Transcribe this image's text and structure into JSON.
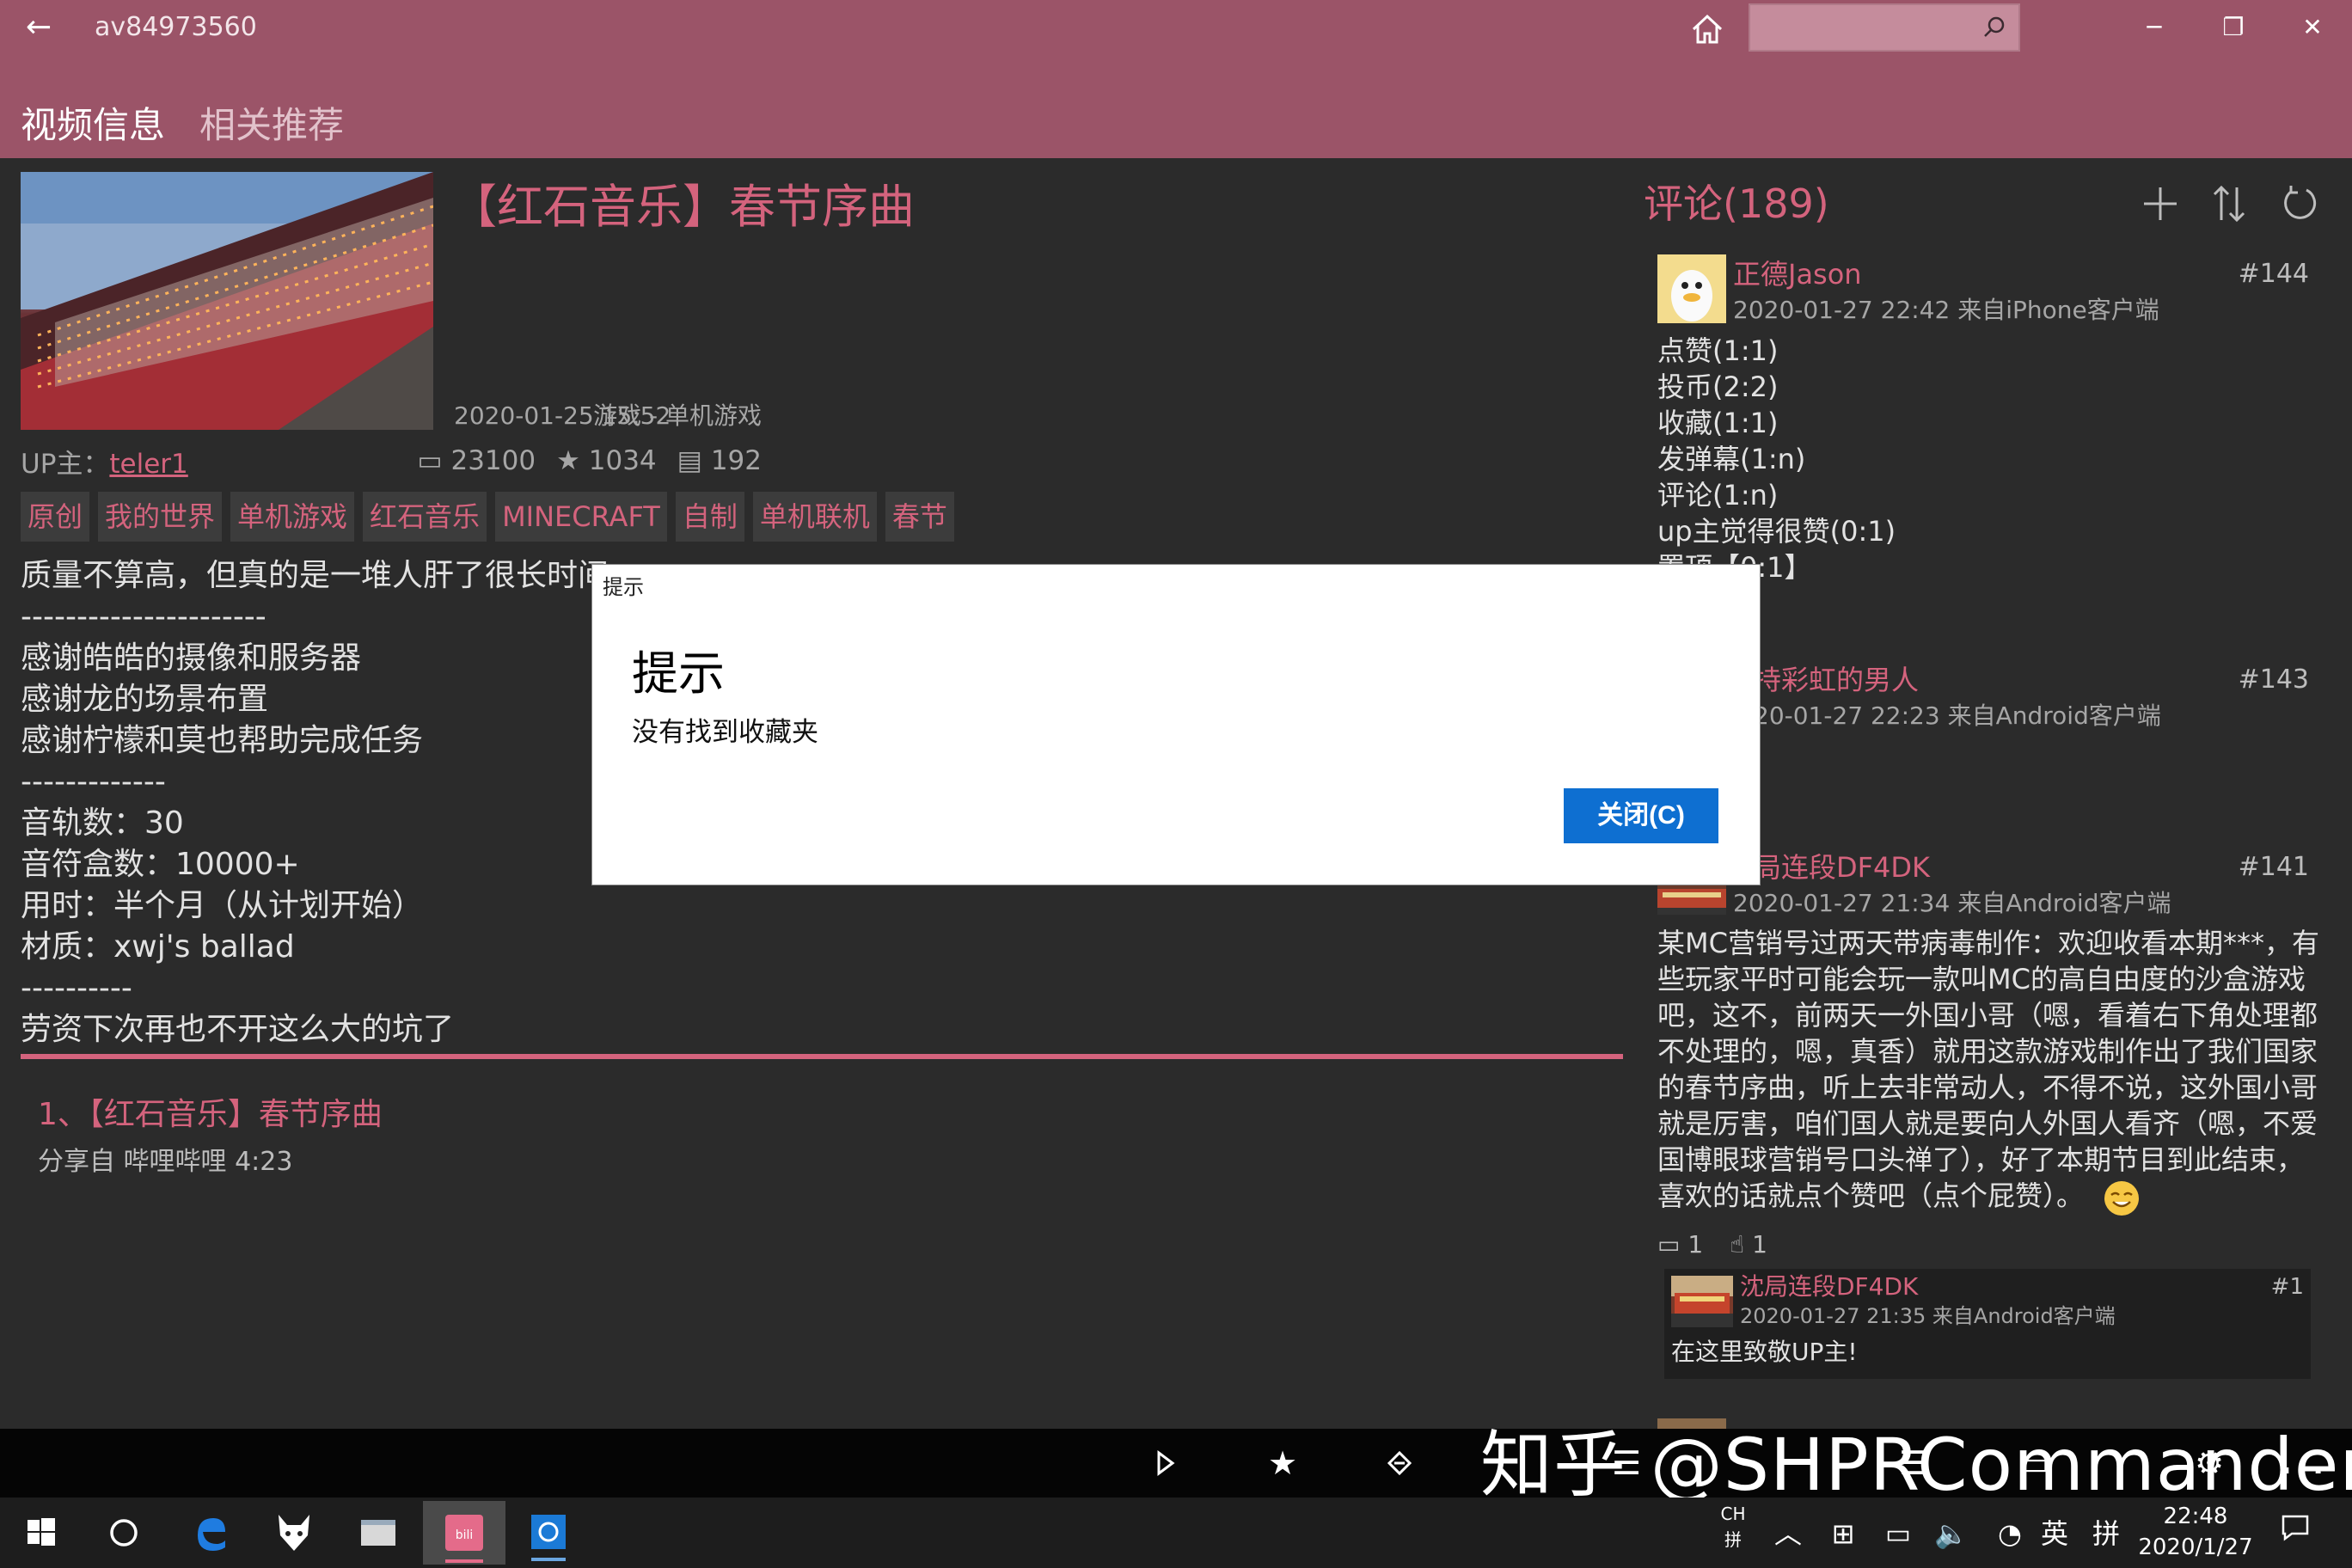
{
  "window": {
    "title": "av84973560",
    "back_icon": "←",
    "minimize": "─",
    "restore": "❐",
    "close": "✕"
  },
  "tabs": [
    "视频信息",
    "相关推荐"
  ],
  "video": {
    "title": "【红石音乐】春节序曲",
    "date": "2020-01-25 15:52",
    "category": "游戏 - 单机游戏",
    "up_label": "UP主：",
    "up_name": "teler1",
    "views": "23100",
    "favorites": "1034",
    "danmaku": "192",
    "tags": [
      "原创",
      "我的世界",
      "单机游戏",
      "红石音乐",
      "MINECRAFT",
      "自制",
      "单机联机",
      "春节"
    ],
    "description": [
      "质量不算高，但真的是一堆人肝了很长时间",
      "----------------------",
      "感谢皓皓的摄像和服务器",
      "感谢龙的场景布置",
      "感谢柠檬和莫也帮助完成任务",
      "-------------",
      "音轨数：30",
      "音符盒数：10000+",
      "用时：半个月（从计划开始）",
      "材质：xwj's ballad",
      "----------",
      "劳资下次再也不开这么大的坑了"
    ],
    "part_title": "1、【红石音乐】春节序曲",
    "part_info": "分享自 哔哩哔哩 4:23"
  },
  "comments": {
    "header": "评论(189)",
    "items": [
      {
        "user": "正德Jason",
        "num": "#144",
        "meta": "2020-01-27 22:42 来自iPhone客户端",
        "lines": [
          "点赞(1:1)",
          "投币(2:2)",
          "收藏(1:1)",
          "发弹幕(1:n)",
          "评论(1:n)",
          "up主觉得很赞(0:1)",
          "置顶【0:1】"
        ]
      },
      {
        "user": "持彩虹的男人",
        "num": "#143",
        "meta": "20-01-27 22:23 来自Android客户端"
      },
      {
        "user": "局连段DF4DK",
        "num": "#141",
        "meta": "2020-01-27 21:34 来自Android客户端",
        "lines": [
          "某MC营销号过两天带病毒制作：欢迎收看本期***，有",
          "些玩家平时可能会玩一款叫MC的高自由度的沙盒游戏",
          "吧，这不，前两天一外国小哥（嗯，看着右下角处理都",
          "不处理的，嗯，真香）就用这款游戏制作出了我们国家",
          "的春节序曲，听上去非常动人，不得不说，这外国小哥",
          "就是厉害，咱们国人就是要向人外国人看齐（嗯，不爱",
          "国博眼球营销号口头禅了），好了本期节目到此结束，",
          "喜欢的话就点个赞吧（点个屁赞）。"
        ],
        "replies": "1",
        "likes": "1",
        "reply": {
          "user": "沈局连段DF4DK",
          "num": "#1",
          "meta": "2020-01-27 21:35 来自Android客户端",
          "text": "在这里致敬UP主!"
        }
      }
    ]
  },
  "dialog": {
    "caption": "提示",
    "title": "提示",
    "message": "没有找到收藏夹",
    "close_button": "关闭(C)"
  },
  "watermark": "知乎 @SHPRCommander",
  "taskbar": {
    "ime_top": "CH",
    "ime_bottom": "拼",
    "lang": "英",
    "ime2": "拼",
    "time": "22:48",
    "date": "2020/1/27"
  },
  "colors": {
    "accent": "#9b5468",
    "link": "#d4637d",
    "dialog_button": "#0e6fd1"
  }
}
